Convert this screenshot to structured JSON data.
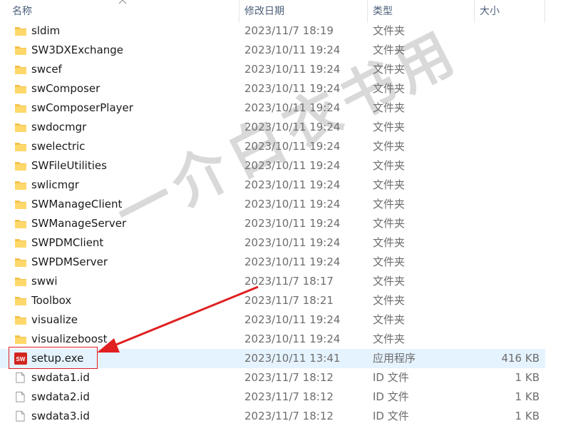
{
  "header": {
    "name": "名称",
    "modified": "修改日期",
    "type": "类型",
    "size": "大小"
  },
  "files": [
    {
      "name": "sldim",
      "date": "2023/11/7 18:19",
      "type": "文件夹",
      "size": "",
      "icon": "folder-icon"
    },
    {
      "name": "SW3DXExchange",
      "date": "2023/10/11 19:24",
      "type": "文件夹",
      "size": "",
      "icon": "folder-icon"
    },
    {
      "name": "swcef",
      "date": "2023/10/11 19:24",
      "type": "文件夹",
      "size": "",
      "icon": "folder-icon"
    },
    {
      "name": "swComposer",
      "date": "2023/10/11 19:24",
      "type": "文件夹",
      "size": "",
      "icon": "folder-icon"
    },
    {
      "name": "swComposerPlayer",
      "date": "2023/10/11 19:24",
      "type": "文件夹",
      "size": "",
      "icon": "folder-icon"
    },
    {
      "name": "swdocmgr",
      "date": "2023/10/11 19:24",
      "type": "文件夹",
      "size": "",
      "icon": "folder-icon"
    },
    {
      "name": "swelectric",
      "date": "2023/10/11 19:24",
      "type": "文件夹",
      "size": "",
      "icon": "folder-icon"
    },
    {
      "name": "SWFileUtilities",
      "date": "2023/10/11 19:24",
      "type": "文件夹",
      "size": "",
      "icon": "folder-icon"
    },
    {
      "name": "swlicmgr",
      "date": "2023/10/11 19:24",
      "type": "文件夹",
      "size": "",
      "icon": "folder-icon"
    },
    {
      "name": "SWManageClient",
      "date": "2023/10/11 19:24",
      "type": "文件夹",
      "size": "",
      "icon": "folder-icon"
    },
    {
      "name": "SWManageServer",
      "date": "2023/10/11 19:24",
      "type": "文件夹",
      "size": "",
      "icon": "folder-icon"
    },
    {
      "name": "SWPDMClient",
      "date": "2023/10/11 19:24",
      "type": "文件夹",
      "size": "",
      "icon": "folder-icon"
    },
    {
      "name": "SWPDMServer",
      "date": "2023/10/11 19:24",
      "type": "文件夹",
      "size": "",
      "icon": "folder-icon"
    },
    {
      "name": "swwi",
      "date": "2023/11/7 18:17",
      "type": "文件夹",
      "size": "",
      "icon": "folder-icon"
    },
    {
      "name": "Toolbox",
      "date": "2023/11/7 18:21",
      "type": "文件夹",
      "size": "",
      "icon": "folder-icon"
    },
    {
      "name": "visualize",
      "date": "2023/10/11 19:24",
      "type": "文件夹",
      "size": "",
      "icon": "folder-icon"
    },
    {
      "name": "visualizeboost",
      "date": "2023/10/11 19:24",
      "type": "文件夹",
      "size": "",
      "icon": "folder-icon"
    },
    {
      "name": "setup.exe",
      "date": "2023/10/11 13:41",
      "type": "应用程序",
      "size": "416 KB",
      "icon": "solidworks-app-icon",
      "selected": true
    },
    {
      "name": "swdata1.id",
      "date": "2023/11/7 18:12",
      "type": "ID 文件",
      "size": "1 KB",
      "icon": "file-icon"
    },
    {
      "name": "swdata2.id",
      "date": "2023/11/7 18:12",
      "type": "ID 文件",
      "size": "1 KB",
      "icon": "file-icon"
    },
    {
      "name": "swdata3.id",
      "date": "2023/11/7 18:12",
      "type": "ID 文件",
      "size": "1 KB",
      "icon": "file-icon"
    }
  ],
  "app_icon_label": "SW",
  "watermark": "一介白衣书用",
  "colors": {
    "folder": "#f4c24a",
    "selected_row": "#e5f3ff",
    "annotation": "#e02020",
    "app_icon": "#d1251f"
  }
}
